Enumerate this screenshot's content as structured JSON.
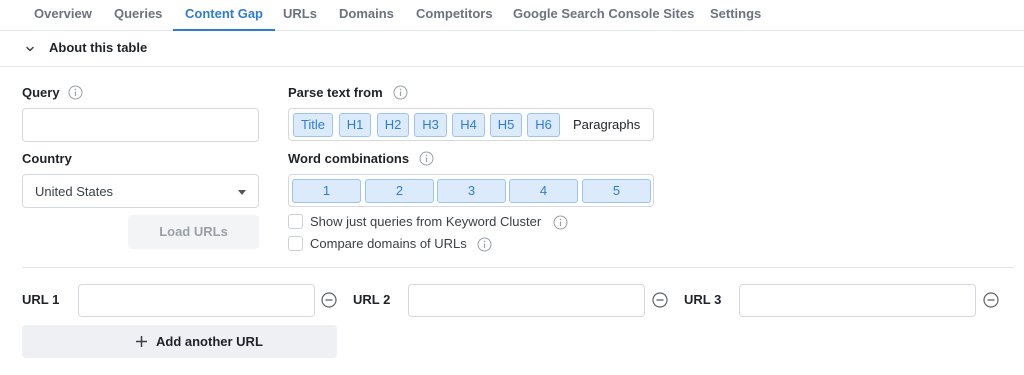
{
  "tabs": [
    {
      "label": "Overview",
      "active": false
    },
    {
      "label": "Queries",
      "active": false
    },
    {
      "label": "Content Gap",
      "active": true
    },
    {
      "label": "URLs",
      "active": false
    },
    {
      "label": "Domains",
      "active": false
    },
    {
      "label": "Competitors",
      "active": false
    },
    {
      "label": "Google Search Console Sites",
      "active": false
    },
    {
      "label": "Settings",
      "active": false
    }
  ],
  "about": {
    "title": "About this table",
    "icon": "chevron-down-icon"
  },
  "form": {
    "query_label": "Query",
    "query_value": "",
    "country_label": "Country",
    "country_value": "United States",
    "load_button": "Load URLs",
    "parse_label": "Parse text from",
    "parse_options": [
      {
        "label": "Title",
        "selected": true
      },
      {
        "label": "H1",
        "selected": true
      },
      {
        "label": "H2",
        "selected": true
      },
      {
        "label": "H3",
        "selected": true
      },
      {
        "label": "H4",
        "selected": true
      },
      {
        "label": "H5",
        "selected": true
      },
      {
        "label": "H6",
        "selected": true
      },
      {
        "label": "Paragraphs",
        "selected": false
      }
    ],
    "word_comb_label": "Word combinations",
    "word_comb_options": [
      {
        "label": "1",
        "selected": true
      },
      {
        "label": "2",
        "selected": true
      },
      {
        "label": "3",
        "selected": true
      },
      {
        "label": "4",
        "selected": true
      },
      {
        "label": "5",
        "selected": true
      }
    ],
    "checkbox_cluster": {
      "label": "Show just queries from Keyword Cluster",
      "checked": false
    },
    "checkbox_compare": {
      "label": "Compare domains of URLs",
      "checked": false
    }
  },
  "urls": [
    {
      "label": "URL 1",
      "value": ""
    },
    {
      "label": "URL 2",
      "value": ""
    },
    {
      "label": "URL 3",
      "value": ""
    }
  ],
  "add_url_button": "Add another URL",
  "colors": {
    "accent": "#2f7dd1",
    "chip_bg": "#dcebfb",
    "chip_border": "#9cc4ee"
  }
}
